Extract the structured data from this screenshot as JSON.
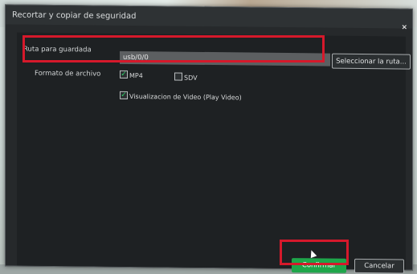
{
  "dialog": {
    "title": "Recortar y copiar de seguridad",
    "close_label": "×"
  },
  "form": {
    "path_label": "Ruta para guardada",
    "path_value": "usb/0/0",
    "select_path_label": "Seleccionar la ruta...",
    "format_label": "Formato de archivo",
    "options": [
      {
        "label": "MP4",
        "checked": true
      },
      {
        "label": "SDV",
        "checked": false
      },
      {
        "label": "Visualizacion de Video (Play Video)",
        "checked": true
      }
    ]
  },
  "buttons": {
    "confirm_label": "Confirmar",
    "cancel_label": "Cancelar"
  },
  "colors": {
    "highlight": "#d6192b",
    "primary": "#1ea64a",
    "check": "#2fd16b"
  }
}
